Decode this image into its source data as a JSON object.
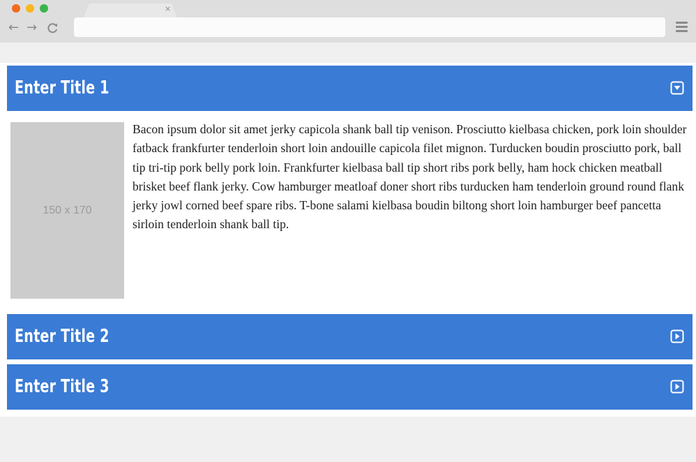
{
  "browser": {
    "tab_close": "×",
    "url": "",
    "nav": {
      "back": "←",
      "forward": "→",
      "reload": "C"
    }
  },
  "accordion": {
    "items": [
      {
        "title": "Enter Title 1",
        "state": "expanded",
        "toggle_icon": "chevron-down-square-icon"
      },
      {
        "title": "Enter Title 2",
        "state": "collapsed",
        "toggle_icon": "chevron-right-square-icon"
      },
      {
        "title": "Enter Title 3",
        "state": "collapsed",
        "toggle_icon": "chevron-right-square-icon"
      }
    ],
    "panel": {
      "image_label": "150 x 170",
      "text": "Bacon ipsum dolor sit amet jerky capicola shank ball tip venison. Prosciutto kielbasa chicken, pork loin shoulder fatback frankfurter tenderloin short loin andouille capicola filet mignon. Turducken boudin prosciutto pork, ball tip tri-tip pork belly pork loin. Frankfurter kielbasa ball tip short ribs pork belly, ham hock chicken meatball brisket beef flank jerky. Cow hamburger meatloaf doner short ribs turducken ham tenderloin ground round flank jerky jowl corned beef spare ribs. T-bone salami kielbasa boudin biltong short loin hamburger beef pancetta sirloin tenderloin shank ball tip."
    }
  },
  "colors": {
    "header_bg": "#3a7bd5",
    "header_text": "#ffffff",
    "placeholder_bg": "#cccccc",
    "page_bg": "#f0f0f0",
    "chrome_bg": "#dedede"
  }
}
